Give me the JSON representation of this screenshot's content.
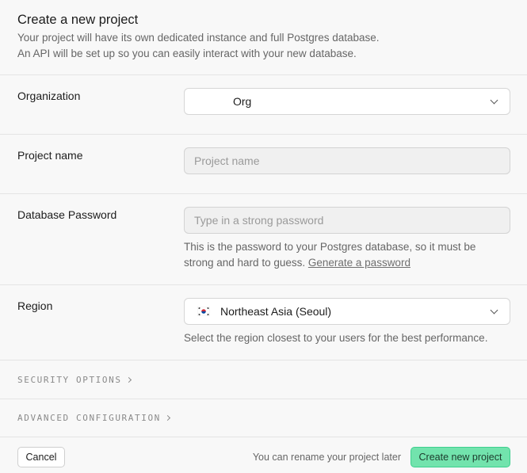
{
  "header": {
    "title": "Create a new project",
    "subtitle_line1": "Your project will have its own dedicated instance and full Postgres database.",
    "subtitle_line2": "An API will be set up so you can easily interact with your new database."
  },
  "organization": {
    "label": "Organization",
    "value": "Org"
  },
  "project_name": {
    "label": "Project name",
    "placeholder": "Project name",
    "value": ""
  },
  "database_password": {
    "label": "Database Password",
    "placeholder": "Type in a strong password",
    "value": "",
    "help_text": "This is the password to your Postgres database, so it must be",
    "help_text2": "strong and hard to guess.",
    "generate_link": "Generate a password"
  },
  "region": {
    "label": "Region",
    "value": "Northeast Asia (Seoul)",
    "flag_icon": "south-korea-flag-icon",
    "help_text": "Select the region closest to your users for the best performance."
  },
  "security_options": {
    "label": "SECURITY OPTIONS"
  },
  "advanced_configuration": {
    "label": "ADVANCED CONFIGURATION"
  },
  "footer": {
    "cancel_label": "Cancel",
    "rename_note": "You can rename your project later",
    "create_label": "Create new project"
  },
  "colors": {
    "accent": "#72e3ad",
    "accent_border": "#3ecf8e",
    "background": "#f8f8f8"
  }
}
